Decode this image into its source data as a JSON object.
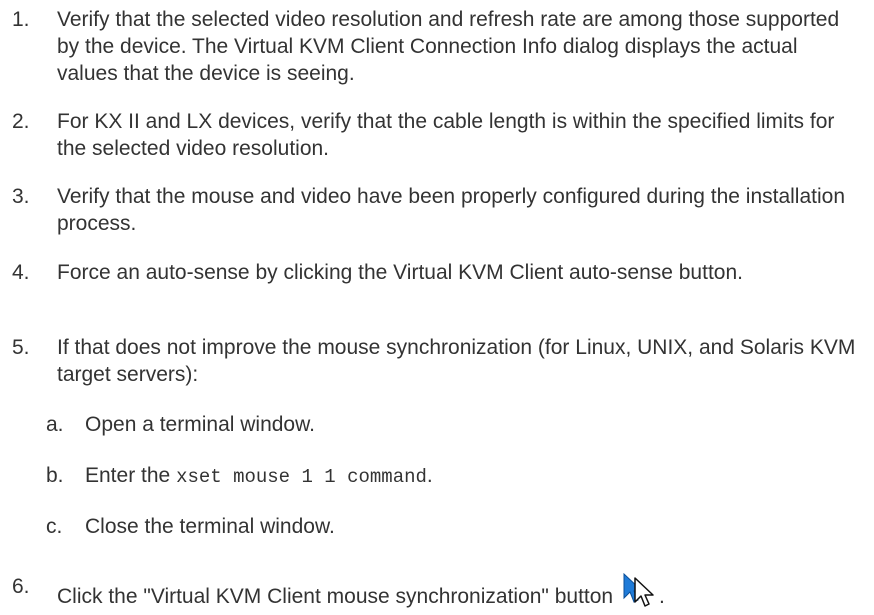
{
  "steps": [
    {
      "num": "1.",
      "text": "Verify that the selected video resolution and refresh rate are among those supported by the device. The Virtual KVM Client Connection Info dialog displays the actual values that the device is seeing."
    },
    {
      "num": "2.",
      "text": "For KX II and LX devices, verify that the cable length is within the specified limits for the selected video resolution."
    },
    {
      "num": "3.",
      "text": "Verify that the mouse and video have been properly configured during the installation process."
    },
    {
      "num": "4.",
      "text": "Force an auto-sense by clicking the Virtual KVM Client auto-sense button."
    },
    {
      "num": "5.",
      "text": "If that does not improve the mouse synchronization (for Linux, UNIX, and Solaris KVM target servers):"
    },
    {
      "num": "6.",
      "text": "Click the \"Virtual KVM Client mouse synchronization\" button",
      "suffix": "."
    }
  ],
  "substeps": [
    {
      "num": "a.",
      "text": "Open a terminal window."
    },
    {
      "num": "b.",
      "text_before": "Enter the ",
      "code": "xset mouse 1 1 command",
      "text_after": "."
    },
    {
      "num": "c.",
      "text": "Close the terminal window."
    }
  ],
  "icons": {
    "sync_button_icon": "mouse-synchronization-icon",
    "accent_color": "#1f7bd8"
  }
}
